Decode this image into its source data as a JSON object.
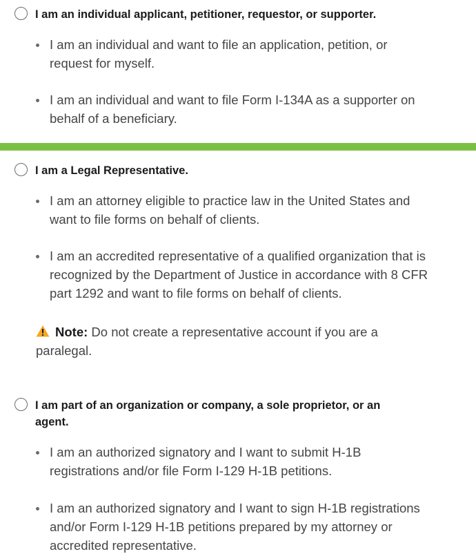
{
  "options": [
    {
      "title": "I am an individual applicant, petitioner, requestor, or supporter.",
      "bullets": [
        [
          "I am an individual and want to file an application, petition, or",
          "request for myself."
        ],
        [
          "I am an individual and want to file Form I-134A as a supporter on",
          "behalf of a beneficiary."
        ]
      ]
    },
    {
      "title": "I am a Legal Representative.",
      "bullets": [
        [
          "I am an attorney eligible to practice law in the United States and",
          "want to file forms on behalf of clients."
        ],
        [
          "I am an accredited representative of a qualified organization that is",
          "recognized by the Department of Justice in accordance with 8 CFR",
          "part 1292 and want to file forms on behalf of clients."
        ]
      ],
      "note": {
        "label": "Note:",
        "text": " Do not create a representative account if you are a",
        "text2": "paralegal."
      }
    },
    {
      "title_lines": [
        "I am part of an organization or company, a sole proprietor, or an",
        "agent."
      ],
      "bullets": [
        [
          "I am an authorized signatory and I want to submit H-1B",
          "registrations and/or file Form I-129 H-1B petitions."
        ],
        [
          "I am an authorized signatory and I want to sign H-1B registrations",
          "and/or Form I-129 H-1B petitions prepared by my attorney or",
          "accredited representative."
        ]
      ]
    }
  ],
  "colors": {
    "divider": "#7ac143",
    "warning": "#f5a623"
  },
  "icons": {
    "radio": "radio-button",
    "warning": "warning-triangle-icon"
  }
}
